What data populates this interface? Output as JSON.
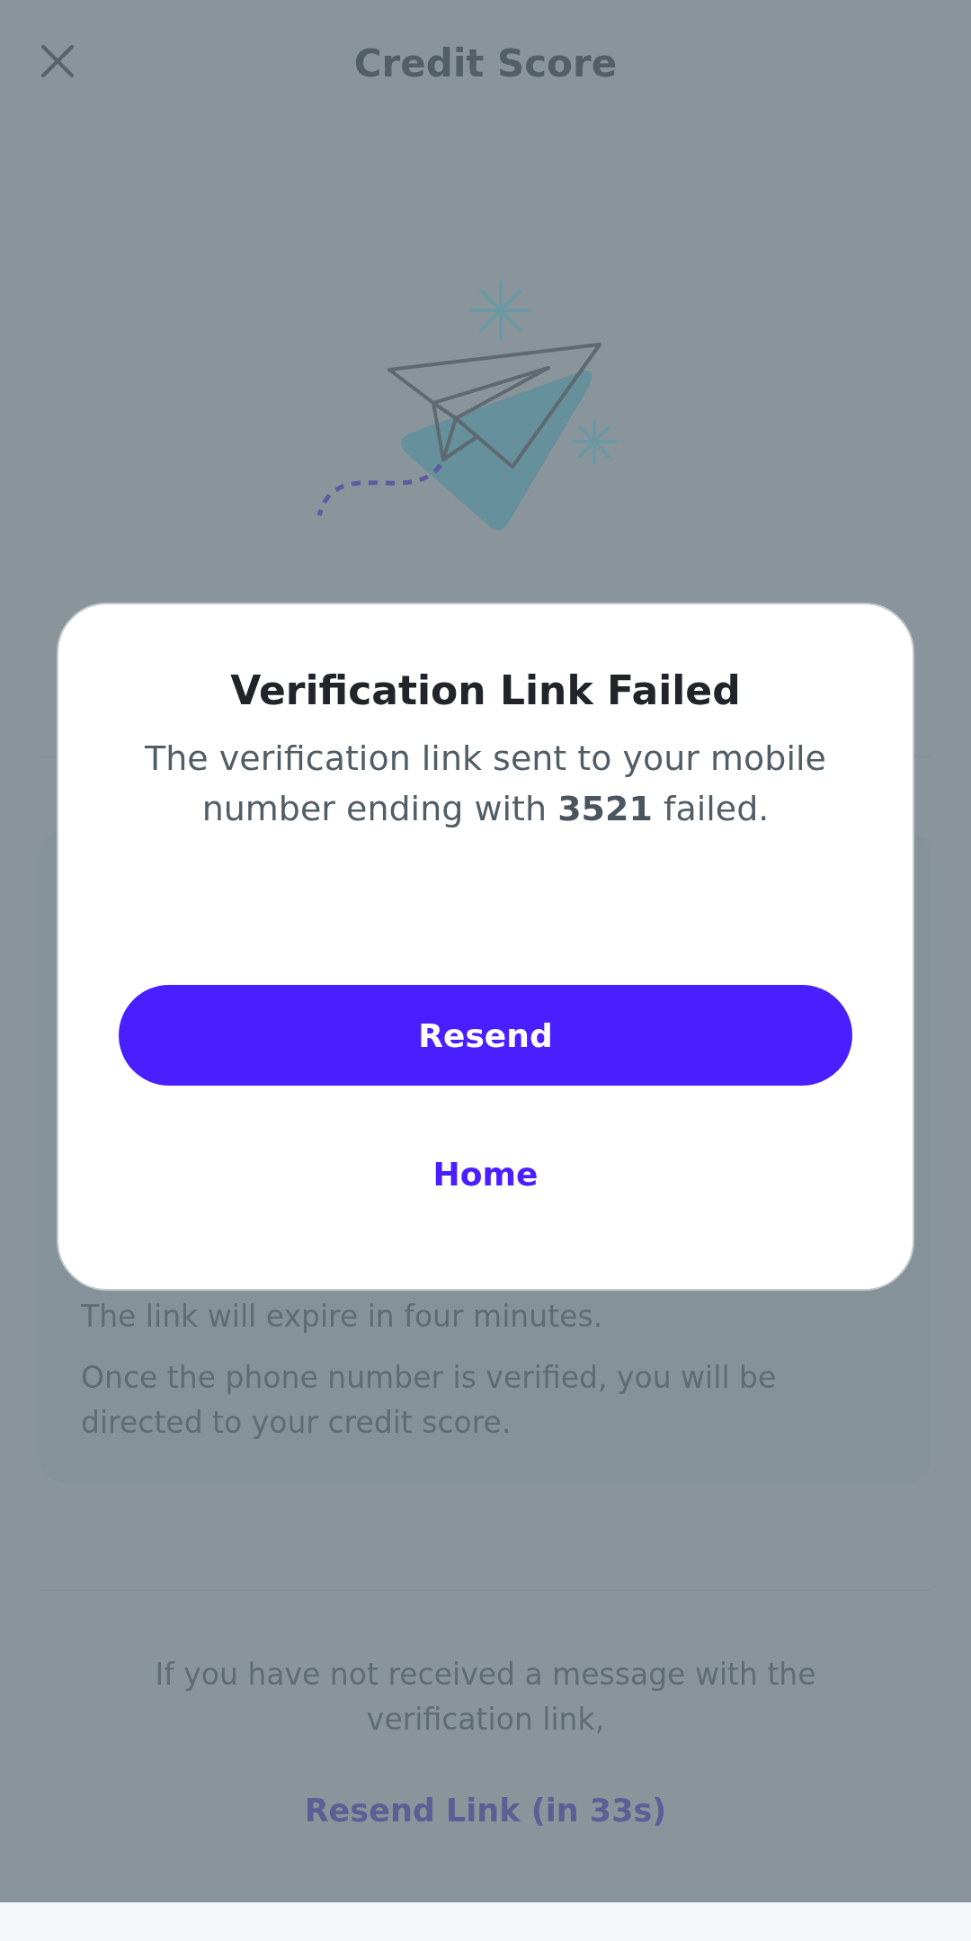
{
  "header": {
    "title": "Credit Score"
  },
  "info_card": {
    "lines": [
      "The link will expire in four minutes.",
      "Once the phone number is verified, you will be directed to your credit score."
    ]
  },
  "resend_prompt": "If you have not received a message with the verification link,",
  "resend_link": {
    "label": "Resend Link (in 33s)",
    "disabled": true
  },
  "dialog": {
    "title": "Verification Link Failed",
    "message": "The verification link sent to your mobile number ending with **3521** failed.",
    "buttons": [
      {
        "label": "Resend",
        "kind": "primary"
      },
      {
        "label": "Home",
        "kind": "text"
      }
    ]
  }
}
